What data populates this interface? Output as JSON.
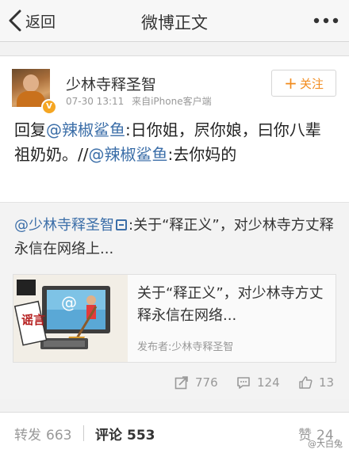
{
  "nav": {
    "back_label": "返回",
    "title": "微博正文"
  },
  "post": {
    "author": "少林寺释圣智",
    "time": "07-30 13:11",
    "source": "来自iPhone客户端",
    "follow_label": "关注",
    "text_parts": {
      "prefix": "回复",
      "mention1": "@辣椒鲨鱼",
      "middle": ":日你姐，屄你娘，曰你八辈祖奶奶。//",
      "mention2": "@辣椒鲨鱼",
      "suffix": ":去你妈的"
    }
  },
  "repost": {
    "author_mention": "@少林寺释圣智",
    "text": ":关于“释正义”，对少林寺方丈释永信在网络上..."
  },
  "link_card": {
    "title": "关于“释正义”，对少林寺方丈释永信在网络...",
    "publisher": "发布者:少林寺释圣智",
    "thumb_text": "谣言"
  },
  "stats": {
    "reposts": "776",
    "comments": "124",
    "likes": "13"
  },
  "bottom_tabs": {
    "repost_label": "转发",
    "repost_count": "663",
    "comment_label": "评论",
    "comment_count": "553",
    "like_label": "赞",
    "like_count": "24"
  },
  "watermark": "@大白兔",
  "colors": {
    "mention": "#3b6ea8",
    "follow": "#f28c1f",
    "verified_badge": "#f5a623"
  }
}
